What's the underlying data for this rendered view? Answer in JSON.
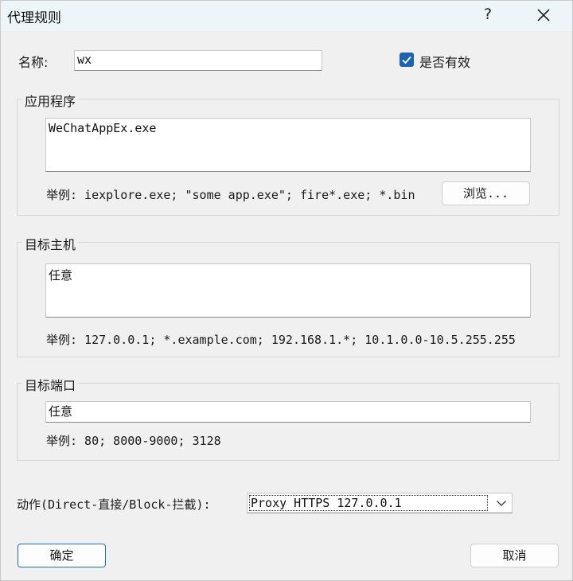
{
  "window": {
    "title": "代理规则",
    "help_label": "?",
    "close_icon": "close-icon"
  },
  "name_field": {
    "label": "名称:",
    "value": "wx"
  },
  "enabled_checkbox": {
    "label": "是否有效",
    "checked": true
  },
  "applications_group": {
    "title": "应用程序",
    "value": "WeChatAppEx.exe",
    "example": "举例: iexplore.exe; \"some app.exe\"; fire*.exe; *.bin",
    "browse_label": "浏览..."
  },
  "target_hosts_group": {
    "title": "目标主机",
    "value": "任意",
    "example": "举例: 127.0.0.1; *.example.com; 192.168.1.*; 10.1.0.0-10.5.255.255"
  },
  "target_ports_group": {
    "title": "目标端口",
    "value": "任意",
    "example": "举例: 80; 8000-9000; 3128"
  },
  "action": {
    "label": "动作(Direct-直接/Block-拦截):",
    "selected": "Proxy HTTPS 127.0.0.1",
    "dropdown_icon": "chevron-down-icon"
  },
  "buttons": {
    "ok_label": "确定",
    "cancel_label": "取消"
  },
  "colors": {
    "accent": "#1b62b3",
    "titlebar": "#eef5f9",
    "window_bg": "#f0f0f0"
  }
}
